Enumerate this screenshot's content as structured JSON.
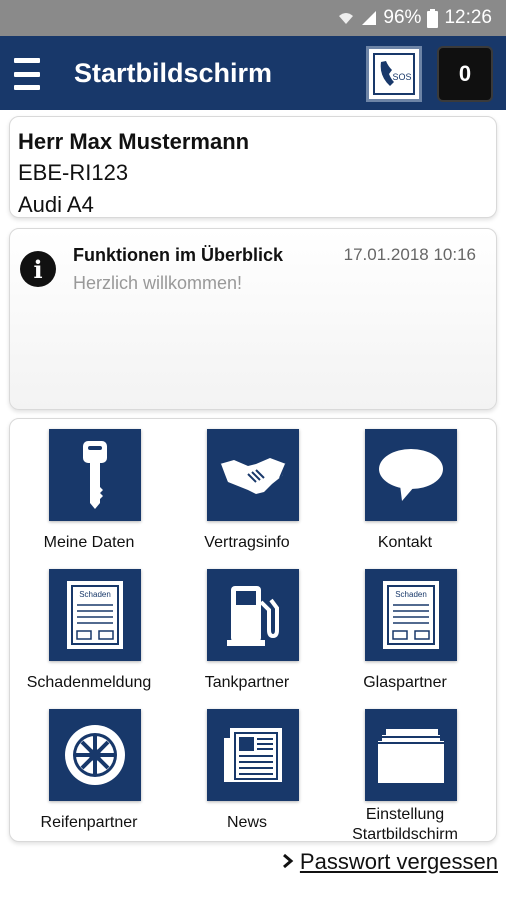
{
  "status_bar": {
    "battery": "96%",
    "time": "12:26"
  },
  "app_bar": {
    "title": "Startbildschirm",
    "counter": "0",
    "sos_label": "SOS"
  },
  "user": {
    "name": "Herr Max Mustermann",
    "plate": "EBE-RI123",
    "car": "Audi A4"
  },
  "message": {
    "title": "Funktionen im Überblick",
    "date": "17.01.2018 10:16",
    "body": "Herzlich willkommen!"
  },
  "tiles": [
    {
      "label": "Meine Daten",
      "icon": "key-icon"
    },
    {
      "label": "Vertragsinfo",
      "icon": "handshake-icon"
    },
    {
      "label": "Kontakt",
      "icon": "speech-bubble-icon"
    },
    {
      "label": "Schadenmeldung",
      "icon": "damage-form-icon",
      "form_text": "Schaden"
    },
    {
      "label": "Tankpartner",
      "icon": "fuel-pump-icon"
    },
    {
      "label": "Glaspartner",
      "icon": "glass-form-icon",
      "form_text": "Schaden"
    },
    {
      "label": "Reifenpartner",
      "icon": "tire-icon"
    },
    {
      "label": "News",
      "icon": "newspaper-icon"
    },
    {
      "label": "Einstellung\nStartbildschirm",
      "icon": "folder-icon",
      "label_line1": "Einstellung",
      "label_line2": "Startbildschirm"
    }
  ],
  "forgot_password": "Passwort vergessen",
  "colors": {
    "primary": "#18386a",
    "status_bar": "#8a8a8a"
  }
}
